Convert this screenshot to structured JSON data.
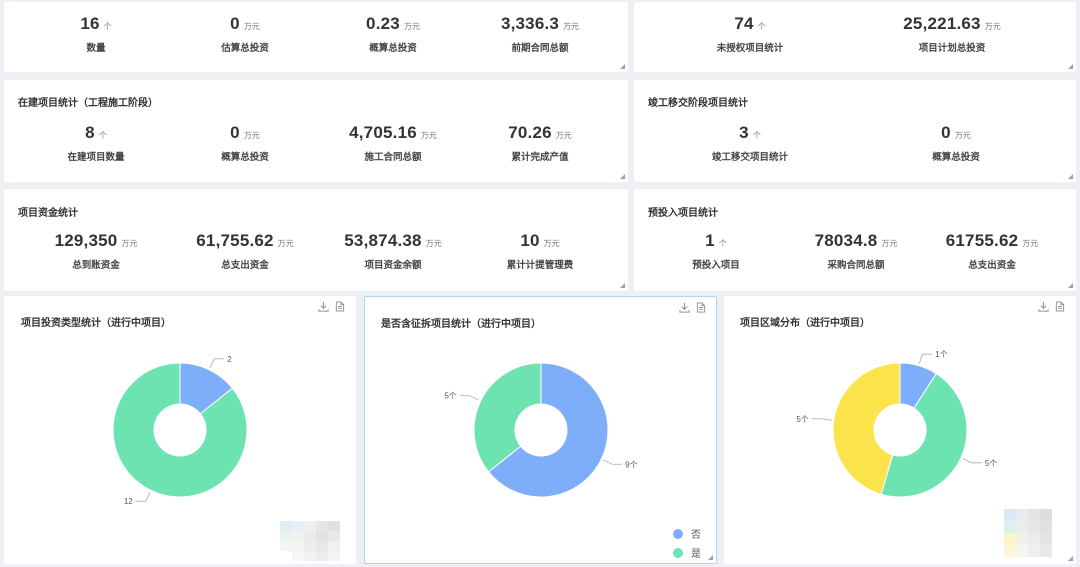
{
  "top_left": {
    "stats": [
      {
        "value": "16",
        "unit": "个",
        "label": "数量"
      },
      {
        "value": "0",
        "unit": "万元",
        "label": "估算总投资"
      },
      {
        "value": "0.23",
        "unit": "万元",
        "label": "概算总投资"
      },
      {
        "value": "3,336.3",
        "unit": "万元",
        "label": "前期合同总额"
      }
    ]
  },
  "top_right": {
    "stats": [
      {
        "value": "74",
        "unit": "个",
        "label": "未授权项目统计"
      },
      {
        "value": "25,221.63",
        "unit": "万元",
        "label": "项目计划总投资"
      }
    ]
  },
  "construction": {
    "title": "在建项目统计（工程施工阶段）",
    "stats": [
      {
        "value": "8",
        "unit": "个",
        "label": "在建项目数量"
      },
      {
        "value": "0",
        "unit": "万元",
        "label": "概算总投资"
      },
      {
        "value": "4,705.16",
        "unit": "万元",
        "label": "施工合同总额"
      },
      {
        "value": "70.26",
        "unit": "万元",
        "label": "累计完成产值"
      }
    ]
  },
  "handover": {
    "title": "竣工移交阶段项目统计",
    "stats": [
      {
        "value": "3",
        "unit": "个",
        "label": "竣工移交项目统计"
      },
      {
        "value": "0",
        "unit": "万元",
        "label": "概算总投资"
      }
    ]
  },
  "funds": {
    "title": "项目资金统计",
    "stats": [
      {
        "value": "129,350",
        "unit": "万元",
        "label": "总到账资金"
      },
      {
        "value": "61,755.62",
        "unit": "万元",
        "label": "总支出资金"
      },
      {
        "value": "53,874.38",
        "unit": "万元",
        "label": "项目资金余额"
      },
      {
        "value": "10",
        "unit": "万元",
        "label": "累计计提管理费"
      }
    ]
  },
  "pre_entry": {
    "title": "预投入项目统计",
    "stats": [
      {
        "value": "1",
        "unit": "个",
        "label": "预投入项目"
      },
      {
        "value": "78034.8",
        "unit": "万元",
        "label": "采购合同总额"
      },
      {
        "value": "61755.62",
        "unit": "万元",
        "label": "总支出资金"
      }
    ]
  },
  "colors": {
    "blue": "#7eaef9",
    "green": "#6de3b1",
    "yellow": "#fbe44b",
    "leader": "#aaaaaa"
  },
  "chart_data": [
    {
      "type": "pie",
      "title": "项目投资类型统计（进行中项目）",
      "slices": [
        {
          "label": "2",
          "value": 2,
          "color": "#7eaef9"
        },
        {
          "label": "12",
          "value": 12,
          "color": "#6de3b1"
        }
      ],
      "legend": []
    },
    {
      "type": "pie",
      "title": "是否含征拆项目统计（进行中项目）",
      "slices": [
        {
          "name": "否",
          "label": "9个",
          "value": 9,
          "color": "#7eaef9"
        },
        {
          "name": "是",
          "label": "5个",
          "value": 5,
          "color": "#6de3b1"
        }
      ],
      "legend": [
        "否",
        "是"
      ],
      "legend_position": "bottom-right"
    },
    {
      "type": "pie",
      "title": "项目区域分布（进行中项目）",
      "slices": [
        {
          "label": "1个",
          "value": 1,
          "color": "#7eaef9"
        },
        {
          "label": "5个",
          "value": 5,
          "color": "#6de3b1"
        },
        {
          "label": "5个",
          "value": 5,
          "color": "#fbe44b"
        }
      ],
      "legend": []
    }
  ]
}
